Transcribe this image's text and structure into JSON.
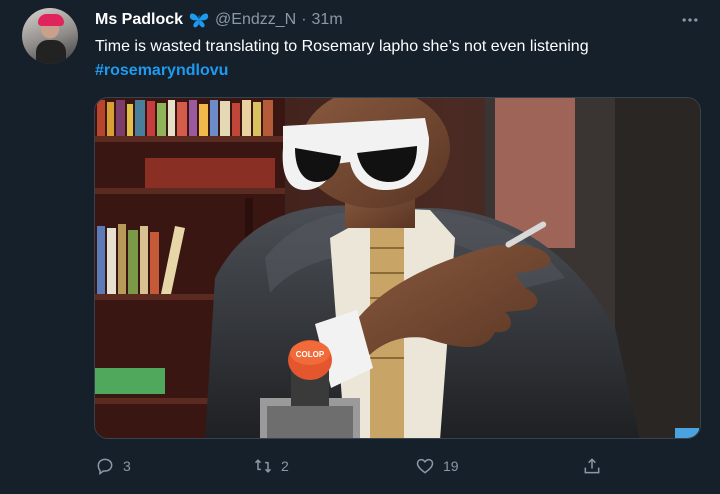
{
  "tweet": {
    "author": {
      "display_name": "Ms Padlock",
      "handle": "@Endzz_N",
      "separator": "·",
      "timestamp": "31m",
      "badge_icon": "butterfly-icon",
      "badge_color": "#1d9bf0"
    },
    "text": "Time is wasted translating to Rosemary lapho she’s not even listening",
    "hashtag": "#rosemaryndlovu",
    "media": {
      "kind": "photo",
      "subject": "man in white sunglasses and black legal robe pointing at an orange COLOP stamp",
      "stamp_brand": "COLOP"
    },
    "actions": {
      "reply": {
        "icon": "reply-icon",
        "count": "3"
      },
      "retweet": {
        "icon": "retweet-icon",
        "count": "2"
      },
      "like": {
        "icon": "heart-icon",
        "count": "19"
      },
      "share": {
        "icon": "share-icon",
        "count": ""
      }
    },
    "more_icon": "more-icon"
  },
  "theme": {
    "background": "#15202b",
    "text_primary": "#ffffff",
    "text_secondary": "#8b98a5",
    "link": "#1d9bf0",
    "border": "#38444d"
  }
}
